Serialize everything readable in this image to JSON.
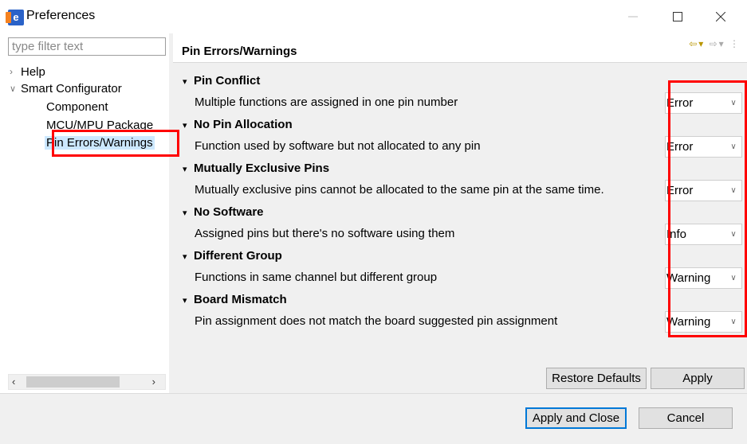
{
  "window": {
    "title": "Preferences",
    "app_icon_letter": "e",
    "controls": [
      "minimize",
      "maximize",
      "close"
    ]
  },
  "sidebar": {
    "filter_placeholder": "type filter text",
    "items": [
      {
        "label": "Help",
        "expanded": false,
        "level": 0
      },
      {
        "label": "Smart Configurator",
        "expanded": true,
        "level": 0
      },
      {
        "label": "Component",
        "level": 1
      },
      {
        "label": "MCU/MPU Package",
        "level": 1
      },
      {
        "label": "Pin Errors/Warnings",
        "level": 1,
        "selected": true
      }
    ]
  },
  "page": {
    "title": "Pin Errors/Warnings",
    "sections": [
      {
        "title": "Pin Conflict",
        "description": "Multiple functions are assigned in one pin number",
        "severity": "Error"
      },
      {
        "title": "No Pin Allocation",
        "description": "Function used by software but not allocated to any pin",
        "severity": "Error"
      },
      {
        "title": "Mutually Exclusive Pins",
        "description": "Mutually exclusive pins cannot be allocated to the same pin at the same time.",
        "severity": "Error"
      },
      {
        "title": "No Software",
        "description": "Assigned pins but there's no software using them",
        "severity": "Info"
      },
      {
        "title": "Different Group",
        "description": "Functions in same channel but different group",
        "severity": "Warning"
      },
      {
        "title": "Board Mismatch",
        "description": "Pin assignment does not match the board suggested pin assignment",
        "severity": "Warning"
      }
    ],
    "restore_defaults": "Restore Defaults",
    "apply": "Apply"
  },
  "footer": {
    "apply_and_close": "Apply and Close",
    "cancel": "Cancel"
  },
  "colors": {
    "highlight": "#ff0000",
    "selection": "#cce8ff",
    "focus_border": "#0078d7"
  }
}
